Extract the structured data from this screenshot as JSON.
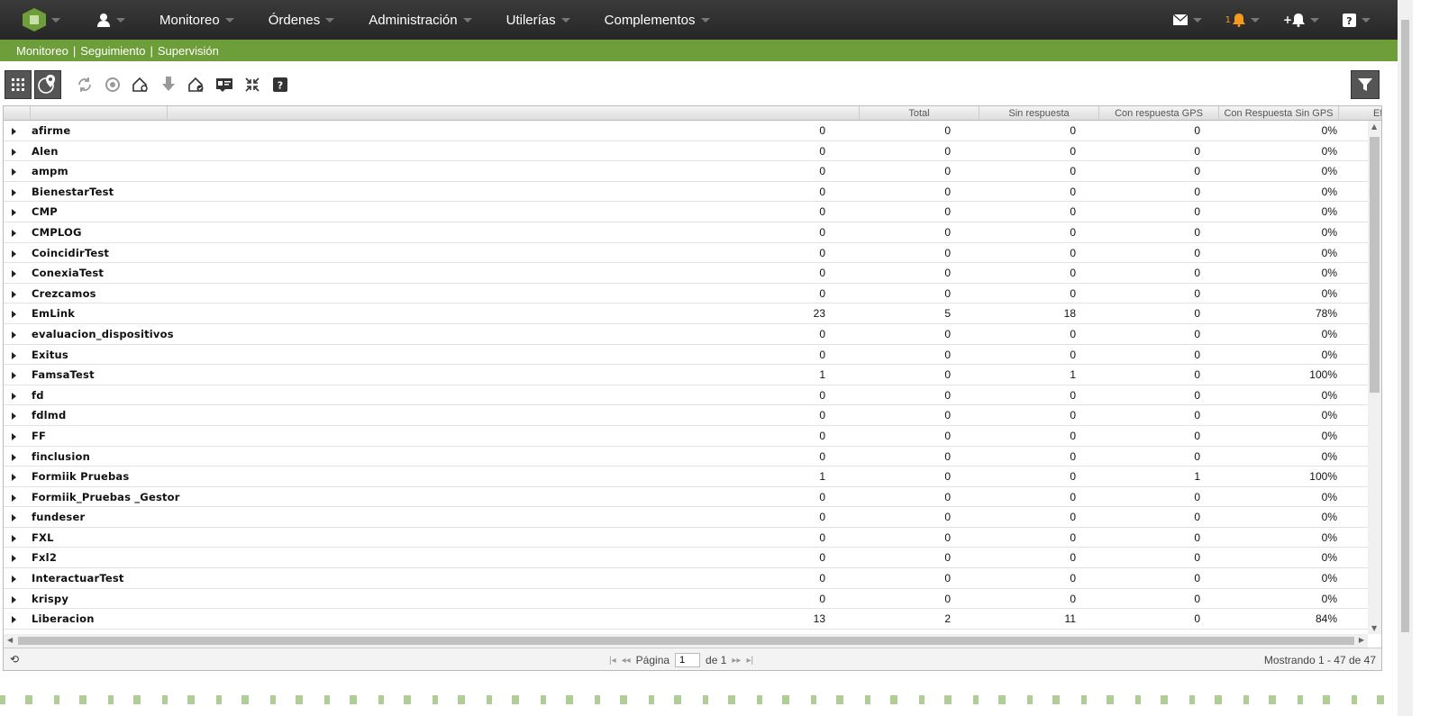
{
  "nav": {
    "items": [
      {
        "label": "Monitoreo"
      },
      {
        "label": "Órdenes"
      },
      {
        "label": "Administración"
      },
      {
        "label": "Utilerías"
      },
      {
        "label": "Complementos"
      }
    ],
    "notification_count": "1"
  },
  "subnav": {
    "items": [
      "Monitoreo",
      "Seguimiento",
      "Supervisión"
    ]
  },
  "grid": {
    "columns": [
      "Total",
      "Sin respuesta",
      "Con respuesta GPS",
      "Con Respuesta Sin GPS",
      "Ef"
    ],
    "rows": [
      {
        "name": "afirme",
        "c1": "0",
        "c2": "0",
        "c3": "0",
        "c4": "0",
        "c5": "0%"
      },
      {
        "name": "Alen",
        "c1": "0",
        "c2": "0",
        "c3": "0",
        "c4": "0",
        "c5": "0%"
      },
      {
        "name": "ampm",
        "c1": "0",
        "c2": "0",
        "c3": "0",
        "c4": "0",
        "c5": "0%"
      },
      {
        "name": "BienestarTest",
        "c1": "0",
        "c2": "0",
        "c3": "0",
        "c4": "0",
        "c5": "0%"
      },
      {
        "name": "CMP",
        "c1": "0",
        "c2": "0",
        "c3": "0",
        "c4": "0",
        "c5": "0%"
      },
      {
        "name": "CMPLOG",
        "c1": "0",
        "c2": "0",
        "c3": "0",
        "c4": "0",
        "c5": "0%"
      },
      {
        "name": "CoincidirTest",
        "c1": "0",
        "c2": "0",
        "c3": "0",
        "c4": "0",
        "c5": "0%"
      },
      {
        "name": "ConexiaTest",
        "c1": "0",
        "c2": "0",
        "c3": "0",
        "c4": "0",
        "c5": "0%"
      },
      {
        "name": "Crezcamos",
        "c1": "0",
        "c2": "0",
        "c3": "0",
        "c4": "0",
        "c5": "0%"
      },
      {
        "name": "EmLink",
        "c1": "23",
        "c2": "5",
        "c3": "18",
        "c4": "0",
        "c5": "78%"
      },
      {
        "name": "evaluacion_dispositivos",
        "c1": "0",
        "c2": "0",
        "c3": "0",
        "c4": "0",
        "c5": "0%"
      },
      {
        "name": "Exitus",
        "c1": "0",
        "c2": "0",
        "c3": "0",
        "c4": "0",
        "c5": "0%"
      },
      {
        "name": "FamsaTest",
        "c1": "1",
        "c2": "0",
        "c3": "1",
        "c4": "0",
        "c5": "100%"
      },
      {
        "name": "fd",
        "c1": "0",
        "c2": "0",
        "c3": "0",
        "c4": "0",
        "c5": "0%"
      },
      {
        "name": "fdlmd",
        "c1": "0",
        "c2": "0",
        "c3": "0",
        "c4": "0",
        "c5": "0%"
      },
      {
        "name": "FF",
        "c1": "0",
        "c2": "0",
        "c3": "0",
        "c4": "0",
        "c5": "0%"
      },
      {
        "name": "finclusion",
        "c1": "0",
        "c2": "0",
        "c3": "0",
        "c4": "0",
        "c5": "0%"
      },
      {
        "name": "Formiik Pruebas",
        "c1": "1",
        "c2": "0",
        "c3": "0",
        "c4": "1",
        "c5": "100%"
      },
      {
        "name": "Formiik_Pruebas _Gestor",
        "c1": "0",
        "c2": "0",
        "c3": "0",
        "c4": "0",
        "c5": "0%"
      },
      {
        "name": "fundeser",
        "c1": "0",
        "c2": "0",
        "c3": "0",
        "c4": "0",
        "c5": "0%"
      },
      {
        "name": "FXL",
        "c1": "0",
        "c2": "0",
        "c3": "0",
        "c4": "0",
        "c5": "0%"
      },
      {
        "name": "Fxl2",
        "c1": "0",
        "c2": "0",
        "c3": "0",
        "c4": "0",
        "c5": "0%"
      },
      {
        "name": "InteractuarTest",
        "c1": "0",
        "c2": "0",
        "c3": "0",
        "c4": "0",
        "c5": "0%"
      },
      {
        "name": "krispy",
        "c1": "0",
        "c2": "0",
        "c3": "0",
        "c4": "0",
        "c5": "0%"
      },
      {
        "name": "Liberacion",
        "c1": "13",
        "c2": "2",
        "c3": "11",
        "c4": "0",
        "c5": "84%"
      }
    ]
  },
  "pager": {
    "page_label": "Página",
    "page_value": "1",
    "of_label": "de 1",
    "summary": "Mostrando 1 - 47 de 47"
  },
  "colors": {
    "accent": "#6d9e3a",
    "topbar": "#2e2e2e",
    "badge": "#f39a1e"
  }
}
